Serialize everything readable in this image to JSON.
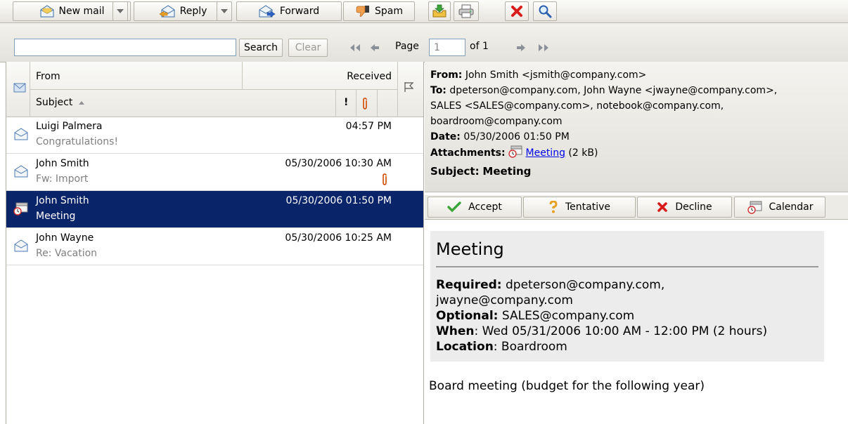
{
  "toolbar": {
    "new_mail": "New mail",
    "reply": "Reply",
    "forward": "Forward",
    "spam": "Spam",
    "icons": [
      "mail-icon",
      "reply-icon",
      "forward-icon",
      "thumbs-down-icon",
      "inbox-download-icon",
      "print-icon",
      "delete-icon",
      "search-icon"
    ]
  },
  "search": {
    "value": "",
    "search_label": "Search",
    "clear_label": "Clear",
    "page_label": "Page",
    "page_value": "1",
    "of_label": "of 1"
  },
  "list": {
    "columns": {
      "from": "From",
      "received": "Received",
      "subject": "Subject",
      "importance": "!"
    },
    "rows": [
      {
        "from": "Luigi Palmera",
        "subject": "Congratulations!",
        "received": "04:57 PM",
        "attachment": false,
        "selected": false,
        "icon": "envelope-icon"
      },
      {
        "from": "John Smith",
        "subject": "Fw: Import",
        "received": "05/30/2006 10:30 AM",
        "attachment": true,
        "selected": false,
        "icon": "envelope-icon"
      },
      {
        "from": "John Smith",
        "subject": "Meeting",
        "received": "05/30/2006 01:50 PM",
        "attachment": false,
        "selected": true,
        "icon": "calendar-icon"
      },
      {
        "from": "John Wayne",
        "subject": "Re: Vacation",
        "received": "05/30/2006 10:25 AM",
        "attachment": false,
        "selected": false,
        "icon": "envelope-icon"
      }
    ]
  },
  "message": {
    "from_label": "From:",
    "from": "John Smith <jsmith@company.com>",
    "to_label": "To:",
    "to_line1": "dpeterson@company.com, John Wayne <jwayne@company.com>,",
    "to_line2": "SALES <SALES@company.com>, notebook@company.com,",
    "to_line3": "boardroom@company.com",
    "date_label": "Date:",
    "date": "05/30/2006 01:50 PM",
    "attachments_label": "Attachments:",
    "attachment_name": "Meeting",
    "attachment_size": "(2 kB)",
    "subject_label": "Subject:",
    "subject": "Meeting"
  },
  "actions": {
    "accept": "Accept",
    "tentative": "Tentative",
    "decline": "Decline",
    "calendar": "Calendar"
  },
  "meeting": {
    "title": "Meeting",
    "required_label": "Required:",
    "required_line1": "dpeterson@company.com,",
    "required_line2": "jwayne@company.com",
    "optional_label": "Optional:",
    "optional": "SALES@company.com",
    "when_label": "When",
    "when": ": Wed 05/31/2006 10:00 AM - 12:00 PM (2 hours)",
    "location_label": "Location",
    "location": ": Boardroom",
    "body": "Board meeting (budget for the following year)"
  },
  "colors": {
    "selection": "#0a246a",
    "link": "#0000ee",
    "attachment_clip": "#d24a00"
  }
}
